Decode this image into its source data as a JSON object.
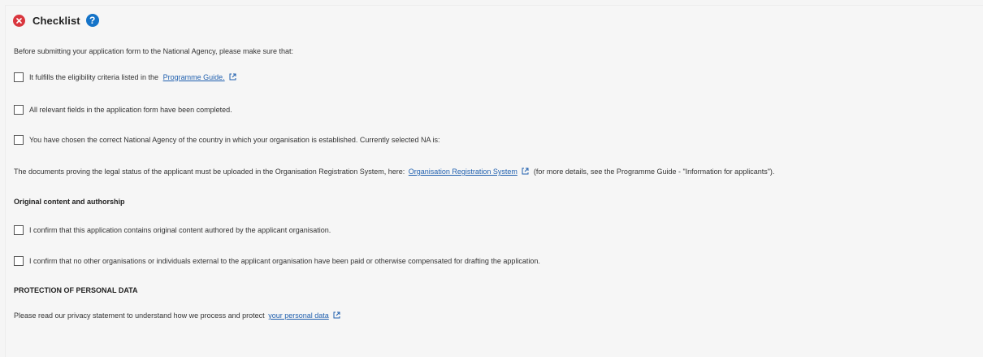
{
  "header": {
    "title": "Checklist",
    "help_glyph": "?",
    "status_icon": "error-x-icon",
    "help_icon": "help-question-icon"
  },
  "colors": {
    "error": "#d9363e",
    "accent": "#1473c8",
    "link": "#1f5fae"
  },
  "intro": "Before submitting your application form to the National Agency, please make sure that:",
  "checks": [
    {
      "before": "It fulfills the eligibility criteria listed in the",
      "link": "Programme Guide.",
      "after": ""
    },
    {
      "before": "All relevant fields in the application form have been completed.",
      "link": "",
      "after": ""
    },
    {
      "before": "You have chosen the correct National Agency of the country in which your organisation is established. Currently selected NA is:",
      "link": "",
      "after": ""
    }
  ],
  "documents": {
    "before": "The documents proving the legal status of the applicant must be uploaded in the Organisation Registration System, here:",
    "link": "Organisation Registration System",
    "after": "(for more details, see the Programme Guide - \"Information for applicants\")."
  },
  "original": {
    "heading": "Original content and authorship",
    "checks": [
      "I confirm that this application contains original content authored by the applicant organisation.",
      "I confirm that no other organisations or individuals external to the applicant organisation have been paid or otherwise compensated for drafting the application."
    ]
  },
  "privacy": {
    "heading": "PROTECTION OF PERSONAL DATA",
    "before": "Please read our privacy statement to understand how we process and protect",
    "link": "your personal data"
  }
}
